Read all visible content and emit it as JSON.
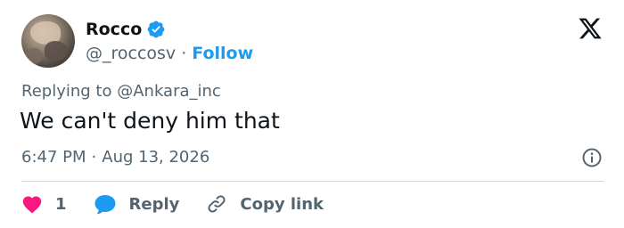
{
  "author": {
    "display_name": "Rocco",
    "handle": "@_roccosv",
    "separator": "·",
    "follow_label": "Follow",
    "verified": true
  },
  "brand": {
    "logo_icon": "x-logo-icon"
  },
  "reply_context": {
    "prefix": "Replying to",
    "mention": "@Ankara_inc"
  },
  "tweet": {
    "text": "We can't deny him that",
    "time": "6:47 PM",
    "separator": "·",
    "date": "Aug 13, 2026"
  },
  "actions": {
    "like_count": "1",
    "reply_label": "Reply",
    "copy_link_label": "Copy link"
  },
  "colors": {
    "accent": "#1d9bf0",
    "like": "#f91880",
    "text_primary": "#0f1419",
    "text_secondary": "#536471",
    "divider": "#cfd9de"
  }
}
